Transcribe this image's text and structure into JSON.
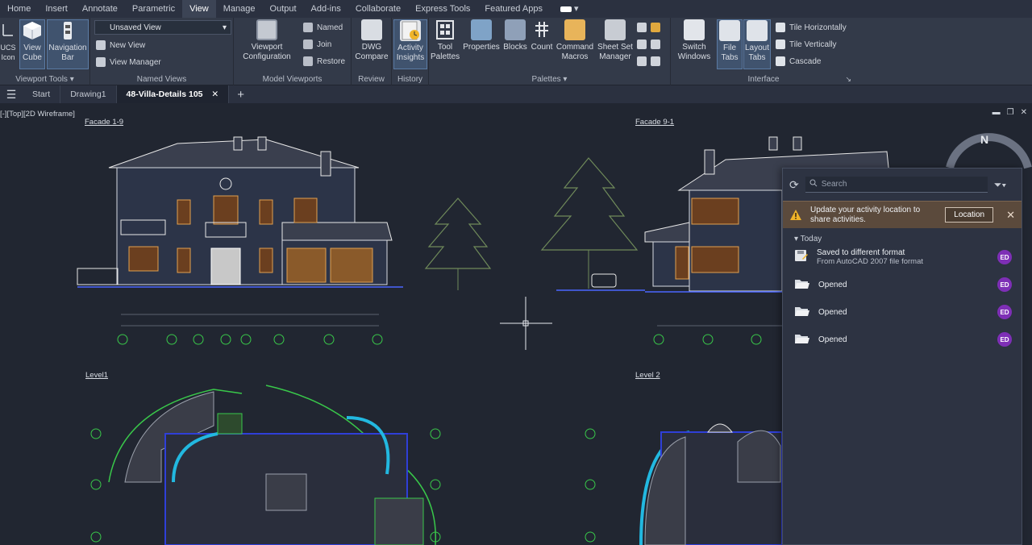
{
  "menu": {
    "items": [
      "Home",
      "Insert",
      "Annotate",
      "Parametric",
      "View",
      "Manage",
      "Output",
      "Add-ins",
      "Collaborate",
      "Express Tools",
      "Featured Apps"
    ],
    "active": "View"
  },
  "ribbon": {
    "viewport_tools": {
      "title": "Viewport Tools",
      "ucs_label": "UCS\nIcon",
      "viewcube_label": "View\nCube",
      "navbar_label": "Navigation\nBar"
    },
    "named_views": {
      "title": "Named Views",
      "dropdown_value": "Unsaved View",
      "new_view": "New View",
      "view_manager": "View Manager"
    },
    "model_viewports": {
      "title": "Model Viewports",
      "config_label": "Viewport\nConfiguration",
      "named": "Named",
      "join": "Join",
      "restore": "Restore"
    },
    "review": {
      "title": "Review",
      "dwg_compare": "DWG\nCompare"
    },
    "history": {
      "title": "History",
      "activity_insights": "Activity\nInsights"
    },
    "palettes": {
      "title": "Palettes",
      "tool_palettes": "Tool\nPalettes",
      "properties": "Properties",
      "blocks": "Blocks",
      "count": "Count",
      "command_macros": "Command\nMacros",
      "sheet_set": "Sheet Set\nManager"
    },
    "interface": {
      "title": "Interface",
      "switch_windows": "Switch\nWindows",
      "file_tabs": "File\nTabs",
      "layout_tabs": "Layout\nTabs",
      "tile_h": "Tile Horizontally",
      "tile_v": "Tile Vertically",
      "cascade": "Cascade"
    }
  },
  "tabs": {
    "items": [
      "Start",
      "Drawing1",
      "48-Villa-Details 105"
    ],
    "active": "48-Villa-Details 105"
  },
  "viewport": {
    "control": "[-][Top][2D Wireframe]",
    "labels": {
      "facade_a": "Facade 1-9",
      "facade_b": "Facade 9-1",
      "level1": "Level1",
      "level2": "Level 2"
    },
    "compass_n": "N"
  },
  "activity": {
    "search_placeholder": "Search",
    "banner_text": "Update your activity location to share activities.",
    "banner_button": "Location",
    "group": "Today",
    "items": [
      {
        "title": "Saved to different format",
        "sub": "From AutoCAD 2007 file format",
        "user": "ED"
      },
      {
        "title": "Opened",
        "sub": "",
        "user": "ED"
      },
      {
        "title": "Opened",
        "sub": "",
        "user": "ED"
      },
      {
        "title": "Opened",
        "sub": "",
        "user": "ED"
      }
    ]
  },
  "colors": {
    "ribbon_bg": "#333a49",
    "canvas_bg": "#212631",
    "accent_green": "#39c84a",
    "avatar_purple": "#7e2fb6",
    "banner_bg": "#5b4a3c"
  }
}
